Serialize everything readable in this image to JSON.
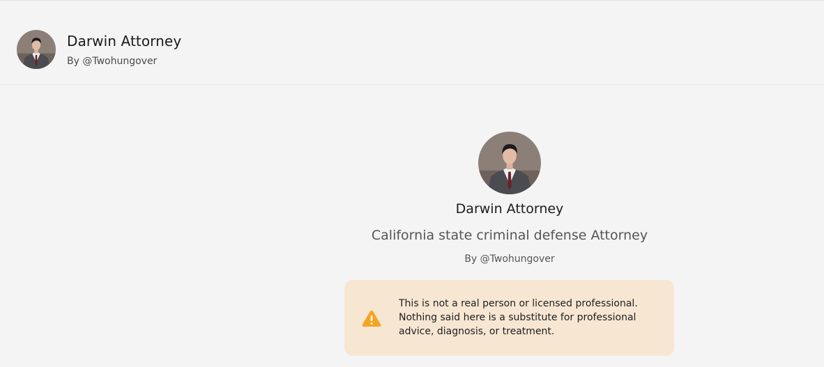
{
  "header": {
    "title": "Darwin Attorney",
    "subtitle": "By @Twohungover",
    "avatar_icon": "attorney-avatar-icon"
  },
  "profile": {
    "name": "Darwin Attorney",
    "description": "California state criminal defense Attorney",
    "by": "By @Twohungover",
    "avatar_icon": "attorney-avatar-icon"
  },
  "disclaimer": {
    "text": "This is not a real person or licensed professional. Nothing said here is a substitute for professional advice, diagnosis, or treatment.",
    "icon": "warning-icon",
    "background_color": "#f7e6d2",
    "icon_color": "#f5a524"
  }
}
